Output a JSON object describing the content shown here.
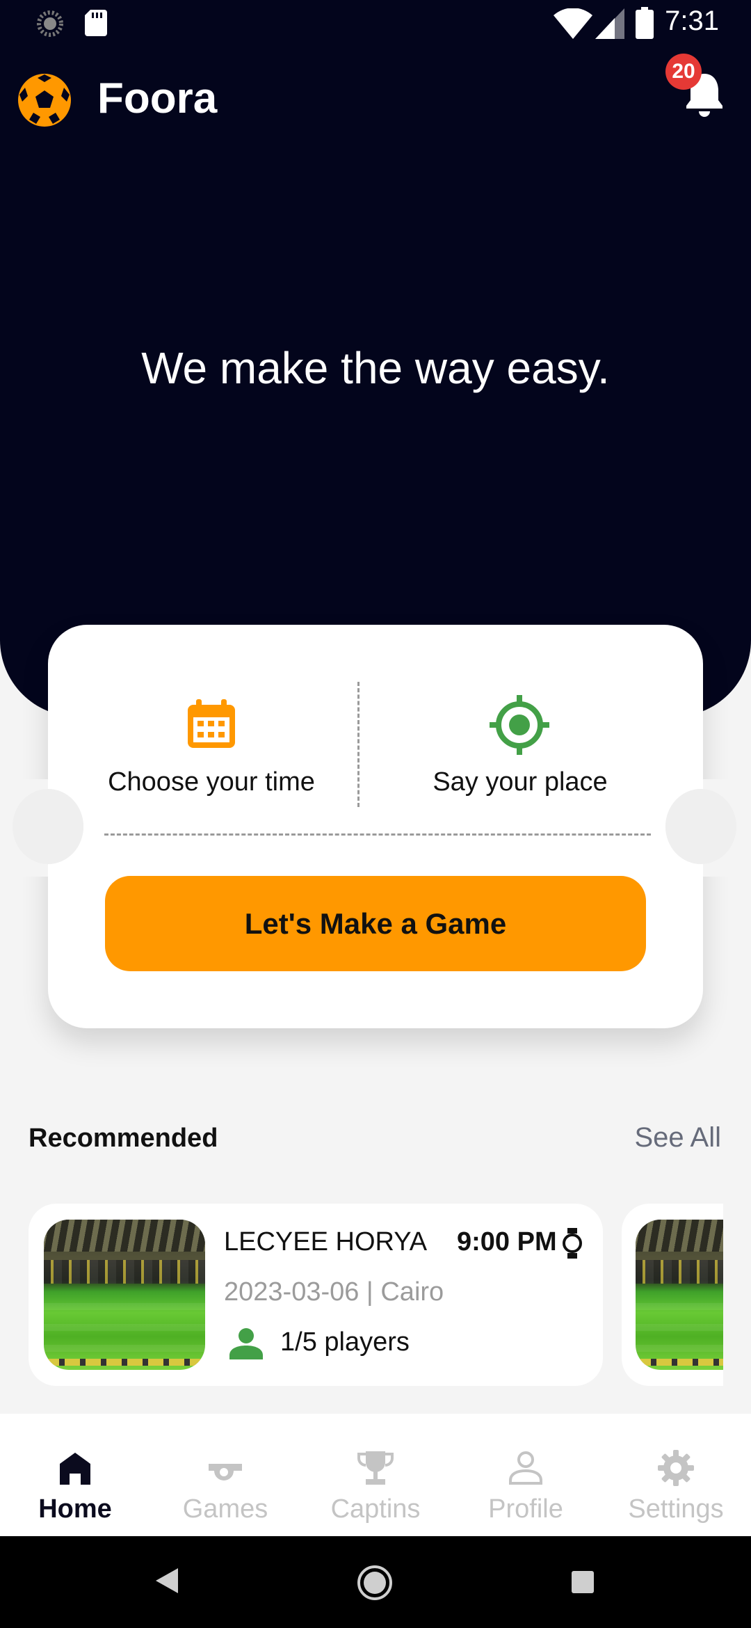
{
  "status_bar": {
    "time": "7:31"
  },
  "header": {
    "app_name": "Foora",
    "notification_count": "20",
    "tagline": "We make the way easy."
  },
  "booking_card": {
    "time_option": {
      "label": "Choose your time",
      "icon": "calendar-icon"
    },
    "place_option": {
      "label": "Say your place",
      "icon": "target-location-icon"
    },
    "cta_label": "Let's Make a Game"
  },
  "recommended": {
    "title": "Recommended",
    "see_all": "See All",
    "games": [
      {
        "name": "LECYEE HORYA",
        "time": "9:00 PM",
        "date_location": "2023-03-06 | Cairo",
        "players": "1/5 players"
      }
    ]
  },
  "bottom_nav": {
    "items": [
      {
        "label": "Home",
        "icon": "home-icon",
        "active": true
      },
      {
        "label": "Games",
        "icon": "whistle-icon",
        "active": false
      },
      {
        "label": "Captins",
        "icon": "trophy-icon",
        "active": false
      },
      {
        "label": "Profile",
        "icon": "person-icon",
        "active": false
      },
      {
        "label": "Settings",
        "icon": "gear-icon",
        "active": false
      }
    ]
  },
  "colors": {
    "header_bg": "#03051c",
    "accent_orange": "#ff9800",
    "accent_green": "#43a047",
    "badge_red": "#e53935"
  }
}
